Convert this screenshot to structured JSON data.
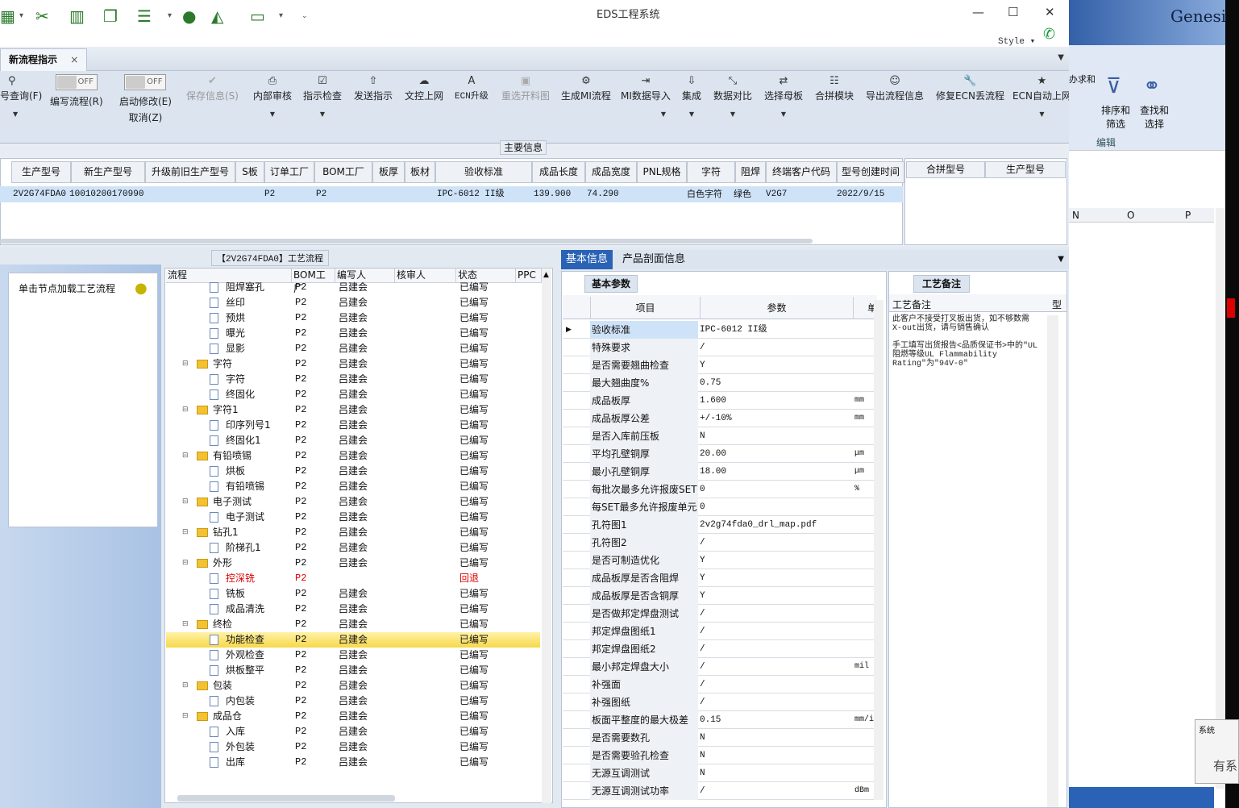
{
  "app": {
    "title": "EDS工程系统",
    "style_label": "Style"
  },
  "tab": {
    "label": "新流程指示",
    "close": "×"
  },
  "ribbon": {
    "query": "号查询(F)",
    "write_flow": "编写流程(R)",
    "start_modify": "启动修改(E)",
    "cancel": "取消(Z)",
    "toggle_off": "OFF",
    "items": [
      "保存信息(S)",
      "内部审核",
      "指示检查",
      "发送指示",
      "文控上网",
      "ECN升级",
      "重选开料图",
      "生成MI流程",
      "MI数据导入",
      "集成",
      "数据对比",
      "选择母板",
      "合拼模块",
      "导出流程信息",
      "修复ECN丢流程",
      "ECN自动上网"
    ]
  },
  "main_info": {
    "section_title": "主要信息",
    "columns": [
      "生产型号",
      "新生产型号",
      "升级前旧生产型号",
      "S板",
      "订单工厂",
      "BOM工厂",
      "板厚",
      "板材",
      "验收标准",
      "成品长度",
      "成品宽度",
      "PNL规格",
      "字符",
      "阻焊",
      "终端客户代码",
      "型号创建时间"
    ],
    "row": [
      "2V2G74FDA0",
      "10010200170990",
      "",
      "",
      "P2",
      "P2",
      "",
      "",
      "IPC-6012 II级",
      "139.900",
      "74.290",
      "",
      "白色字符",
      "绿色",
      "V2G7",
      "2022/9/15"
    ],
    "merge_columns": [
      "合拼型号",
      "生产型号"
    ]
  },
  "left_panel": {
    "hint": "单击节点加载工艺流程"
  },
  "flow": {
    "title": "【2V2G74FDA0】工艺流程",
    "columns": [
      "流程",
      "BOM工厂",
      "编写人",
      "核审人",
      "状态",
      "PPC"
    ],
    "rows": [
      {
        "name": "阻焊塞孔",
        "type": "doc",
        "bom": "P2",
        "writer": "吕建会",
        "status": "已编写"
      },
      {
        "name": "丝印",
        "type": "doc",
        "bom": "P2",
        "writer": "吕建会",
        "status": "已编写"
      },
      {
        "name": "预烘",
        "type": "doc",
        "bom": "P2",
        "writer": "吕建会",
        "status": "已编写"
      },
      {
        "name": "曝光",
        "type": "doc",
        "bom": "P2",
        "writer": "吕建会",
        "status": "已编写"
      },
      {
        "name": "显影",
        "type": "doc",
        "bom": "P2",
        "writer": "吕建会",
        "status": "已编写"
      },
      {
        "name": "字符",
        "type": "folder",
        "bom": "P2",
        "writer": "吕建会",
        "status": "已编写"
      },
      {
        "name": "字符",
        "type": "doc",
        "bom": "P2",
        "writer": "吕建会",
        "status": "已编写"
      },
      {
        "name": "终固化",
        "type": "doc",
        "bom": "P2",
        "writer": "吕建会",
        "status": "已编写"
      },
      {
        "name": "字符1",
        "type": "folder",
        "bom": "P2",
        "writer": "吕建会",
        "status": "已编写"
      },
      {
        "name": "印序列号1",
        "type": "doc",
        "bom": "P2",
        "writer": "吕建会",
        "status": "已编写"
      },
      {
        "name": "终固化1",
        "type": "doc",
        "bom": "P2",
        "writer": "吕建会",
        "status": "已编写"
      },
      {
        "name": "有铅喷锡",
        "type": "folder",
        "bom": "P2",
        "writer": "吕建会",
        "status": "已编写"
      },
      {
        "name": "烘板",
        "type": "doc",
        "bom": "P2",
        "writer": "吕建会",
        "status": "已编写"
      },
      {
        "name": "有铅喷锡",
        "type": "doc",
        "bom": "P2",
        "writer": "吕建会",
        "status": "已编写"
      },
      {
        "name": "电子测试",
        "type": "folder",
        "bom": "P2",
        "writer": "吕建会",
        "status": "已编写"
      },
      {
        "name": "电子测试",
        "type": "doc",
        "bom": "P2",
        "writer": "吕建会",
        "status": "已编写"
      },
      {
        "name": "钻孔1",
        "type": "folder",
        "bom": "P2",
        "writer": "吕建会",
        "status": "已编写"
      },
      {
        "name": "阶梯孔1",
        "type": "doc",
        "bom": "P2",
        "writer": "吕建会",
        "status": "已编写"
      },
      {
        "name": "外形",
        "type": "folder",
        "bom": "P2",
        "writer": "吕建会",
        "status": "已编写"
      },
      {
        "name": "控深铣",
        "type": "doc",
        "bom": "P2",
        "writer": "",
        "status": "回退",
        "red": true
      },
      {
        "name": "铣板",
        "type": "doc",
        "bom": "P2",
        "writer": "吕建会",
        "status": "已编写"
      },
      {
        "name": "成品清洗",
        "type": "doc",
        "bom": "P2",
        "writer": "吕建会",
        "status": "已编写"
      },
      {
        "name": "终检",
        "type": "folder",
        "bom": "P2",
        "writer": "吕建会",
        "status": "已编写"
      },
      {
        "name": "功能检查",
        "type": "doc",
        "bom": "P2",
        "writer": "吕建会",
        "status": "已编写",
        "selected": true
      },
      {
        "name": "外观检查",
        "type": "doc",
        "bom": "P2",
        "writer": "吕建会",
        "status": "已编写"
      },
      {
        "name": "烘板整平",
        "type": "doc",
        "bom": "P2",
        "writer": "吕建会",
        "status": "已编写"
      },
      {
        "name": "包装",
        "type": "folder",
        "bom": "P2",
        "writer": "吕建会",
        "status": "已编写"
      },
      {
        "name": "内包装",
        "type": "doc",
        "bom": "P2",
        "writer": "吕建会",
        "status": "已编写"
      },
      {
        "name": "成品仓",
        "type": "folder",
        "bom": "P2",
        "writer": "吕建会",
        "status": "已编写"
      },
      {
        "name": "入库",
        "type": "doc",
        "bom": "P2",
        "writer": "吕建会",
        "status": "已编写"
      },
      {
        "name": "外包装",
        "type": "doc",
        "bom": "P2",
        "writer": "吕建会",
        "status": "已编写"
      },
      {
        "name": "出库",
        "type": "doc",
        "bom": "P2",
        "writer": "吕建会",
        "status": "已编写"
      }
    ]
  },
  "detail": {
    "tabs": [
      "基本信息",
      "产品剖面信息"
    ],
    "subtab": "基本参数",
    "columns": [
      "项目",
      "参数",
      "单"
    ],
    "params": [
      [
        "验收标准",
        "IPC-6012 II级",
        ""
      ],
      [
        "特殊要求",
        "/",
        ""
      ],
      [
        "是否需要翘曲检查",
        "Y",
        ""
      ],
      [
        "最大翘曲度%",
        "0.75",
        ""
      ],
      [
        "成品板厚",
        "1.600",
        "mm"
      ],
      [
        "成品板厚公差",
        "+/-10%",
        "mm"
      ],
      [
        "是否入库前压板",
        "N",
        ""
      ],
      [
        "平均孔壁铜厚",
        "20.00",
        "μm"
      ],
      [
        "最小孔壁铜厚",
        "18.00",
        "μm"
      ],
      [
        "每批次最多允许报废SET",
        "0",
        "%"
      ],
      [
        "每SET最多允许报废单元",
        "0",
        ""
      ],
      [
        "孔符图1",
        "2v2g74fda0_drl_map.pdf",
        ""
      ],
      [
        "孔符图2",
        "/",
        ""
      ],
      [
        "是否可制造优化",
        "Y",
        ""
      ],
      [
        "成品板厚是否含阻焊",
        "Y",
        ""
      ],
      [
        "成品板厚是否含铜厚",
        "Y",
        ""
      ],
      [
        "是否做邦定焊盘测试",
        "/",
        ""
      ],
      [
        "邦定焊盘图纸1",
        "/",
        ""
      ],
      [
        "邦定焊盘图纸2",
        "/",
        ""
      ],
      [
        "最小邦定焊盘大小",
        "/",
        "mil"
      ],
      [
        "补强面",
        "/",
        ""
      ],
      [
        "补强图纸",
        "/",
        ""
      ],
      [
        "板面平整度的最大极差",
        "0.15",
        "mm/i"
      ],
      [
        "是否需要数孔",
        "N",
        ""
      ],
      [
        "是否需要验孔检查",
        "N",
        ""
      ],
      [
        "无源互调测试",
        "N",
        ""
      ],
      [
        "无源互调测试功率",
        "/",
        "dBm"
      ]
    ]
  },
  "notes": {
    "tab": "工艺备注",
    "header": "工艺备注",
    "col2": "型",
    "text": "此客户不接受打叉板出货，如不够数需X-out出货，请与销售确认\n\n手工填写出货报告<品质保证书>中的\"UL阻燃等级UL Flammability Rating\"为\"94V-0\""
  },
  "excel": {
    "brand": "Genesis",
    "ribbon_items": [
      "办求和",
      "排序和筛选",
      "查找和选择"
    ],
    "group": "编辑",
    "cols": [
      "N",
      "O",
      "P"
    ],
    "popup_title": "系统",
    "popup_text": "有系"
  }
}
